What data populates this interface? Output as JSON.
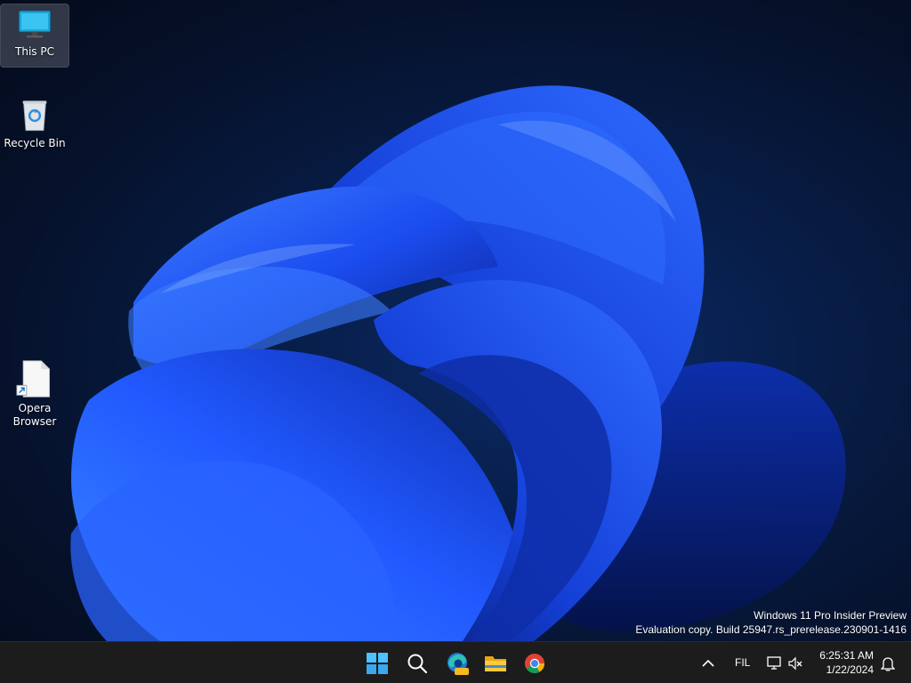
{
  "desktop": {
    "icons": [
      {
        "label": "This PC",
        "icon": "computer-monitor-icon",
        "selected": true
      },
      {
        "label": "Recycle Bin",
        "icon": "recycle-bin-icon",
        "selected": false
      },
      {
        "label": "Opera Browser",
        "icon": "file-shortcut-icon",
        "selected": false
      }
    ],
    "wallpaper": "Windows 11 bloom wallpaper",
    "accent": "#1e5bff"
  },
  "watermark": {
    "line1": "Windows 11 Pro Insider Preview",
    "line2": "Evaluation copy. Build 25947.rs_prerelease.230901-1416"
  },
  "taskbar": {
    "apps": [
      {
        "name": "Start",
        "icon": "windows-start-icon"
      },
      {
        "name": "Search",
        "icon": "search-icon"
      },
      {
        "name": "Microsoft Edge Preview",
        "icon": "edge-preview-icon",
        "badge": "PRE"
      },
      {
        "name": "File Explorer",
        "icon": "folder-icon"
      },
      {
        "name": "Google Chrome",
        "icon": "chrome-icon"
      }
    ],
    "tray": {
      "overflow_icon": "chevron-up-icon",
      "language": "FIL",
      "network_icon": "network-monitor-icon",
      "volume_icon": "volume-muted-icon",
      "time": "6:25:31 AM",
      "date": "1/22/2024",
      "notification_icon": "notification-bell-icon"
    }
  }
}
